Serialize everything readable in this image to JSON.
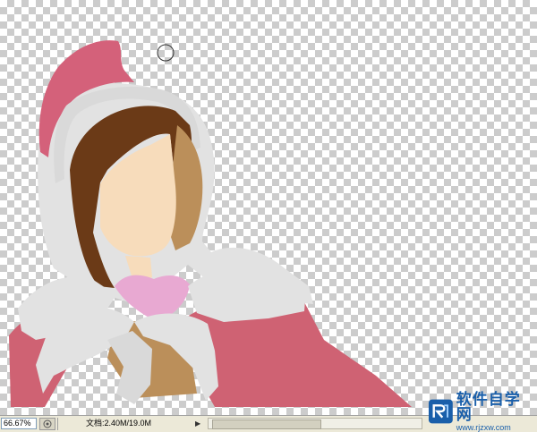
{
  "canvas": {
    "checker_colors": [
      "#ffffff",
      "#cccccc"
    ],
    "artwork_colors": {
      "hat": "#d4617a",
      "hood_fur": "#e2e2e2",
      "hair": "#6b3a17",
      "skin": "#f7dcbb",
      "shading": "#bb8f5a",
      "cloak": "#cf6273",
      "collar": "#e8a9d2"
    },
    "cursor_icon": "brush-circle-cursor-icon"
  },
  "status_bar": {
    "zoom": "66.67%",
    "doc_info": "文档:2.40M/19.0M",
    "icon": "status-info-icon",
    "arrow_icon": "arrow-right-icon"
  },
  "watermark": {
    "title": "软件自学网",
    "url": "www.rjzxw.com",
    "logo_icon": "rj-logo-icon"
  }
}
